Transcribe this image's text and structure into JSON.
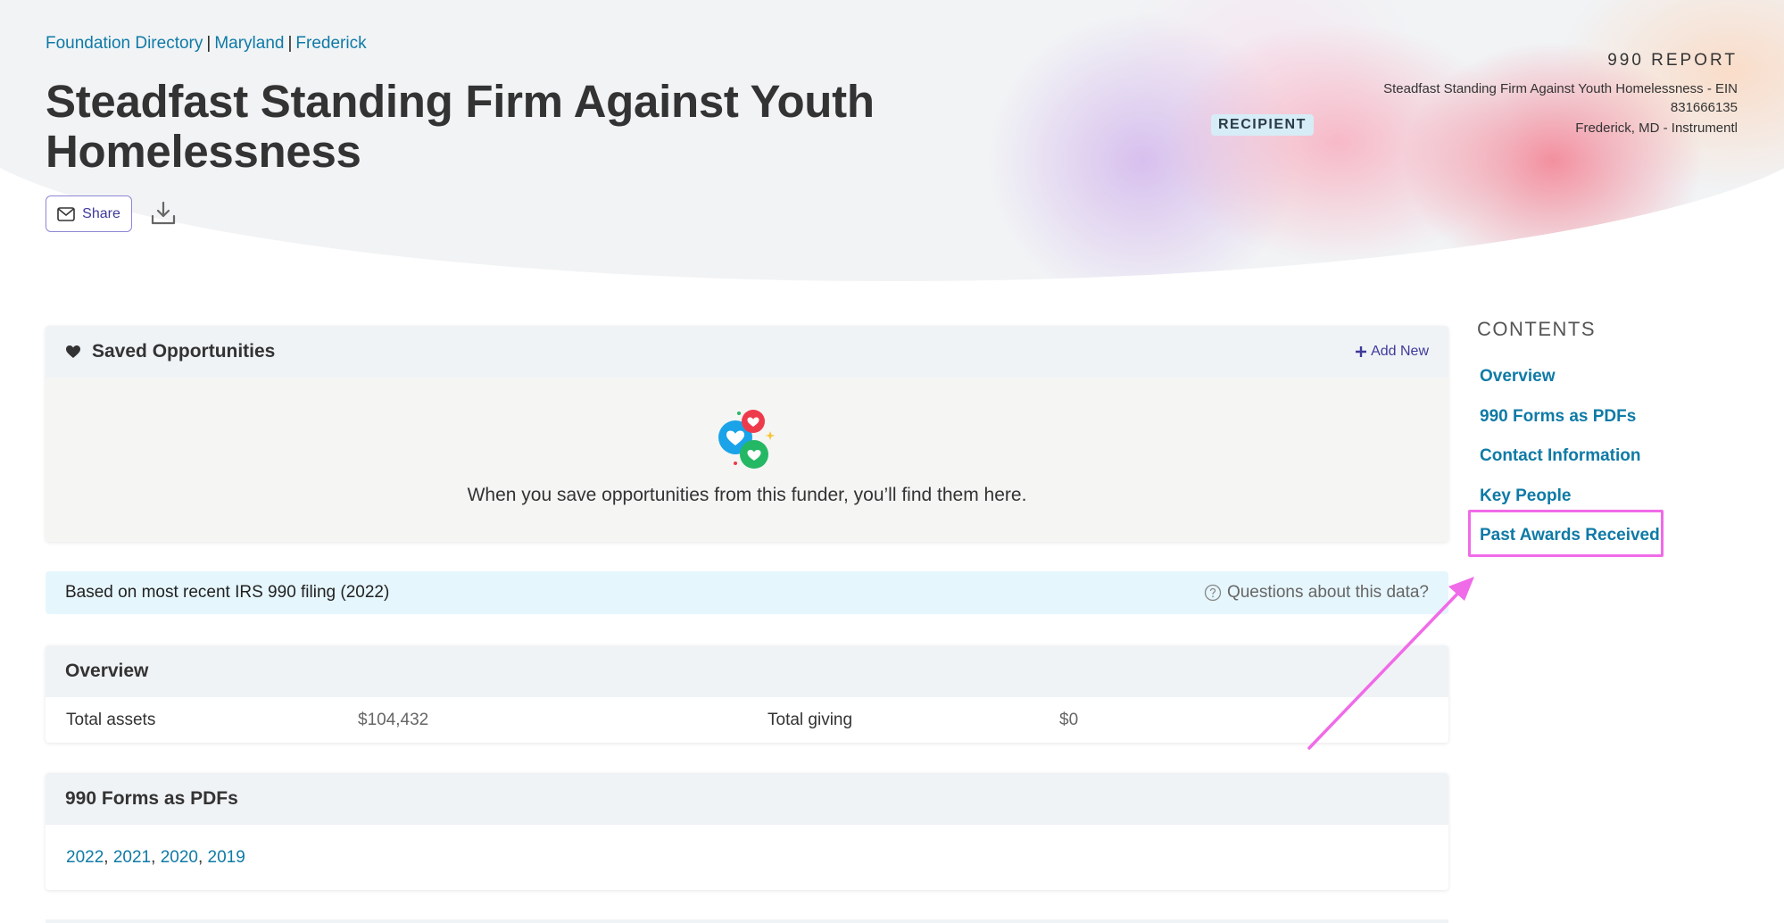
{
  "breadcrumb": {
    "items": [
      "Foundation Directory",
      "Maryland",
      "Frederick"
    ],
    "separator": "|"
  },
  "header": {
    "title": "Steadfast Standing Firm Against Youth Homelessness",
    "share_label": "Share",
    "recipient_badge": "RECIPIENT",
    "report": {
      "title": "990 REPORT",
      "line1": "Steadfast Standing Firm Against Youth Homelessness - EIN",
      "line2": "831666135",
      "line3": "Frederick, MD - Instrumentl"
    }
  },
  "saved_opportunities": {
    "title": "Saved Opportunities",
    "add_new_label": "Add New",
    "empty_message": "When you save opportunities from this funder, you’ll find them here."
  },
  "info_bar": {
    "text": "Based on most recent IRS 990 filing (2022)",
    "questions_label": "Questions about this data?"
  },
  "overview": {
    "title": "Overview",
    "total_assets_label": "Total assets",
    "total_assets_value": "$104,432",
    "total_giving_label": "Total giving",
    "total_giving_value": "$0"
  },
  "forms": {
    "title": "990 Forms as PDFs",
    "years": [
      "2022",
      "2021",
      "2020",
      "2019"
    ]
  },
  "contents": {
    "title": "CONTENTS",
    "items": [
      "Overview",
      "990 Forms as PDFs",
      "Contact Information",
      "Key People",
      "Past Awards Received"
    ],
    "highlighted_index": 4
  },
  "colors": {
    "link": "#0f7aa6",
    "accent": "#3e3a9a",
    "annotation": "#f06be8",
    "info_bar": "#e6f6fd"
  }
}
